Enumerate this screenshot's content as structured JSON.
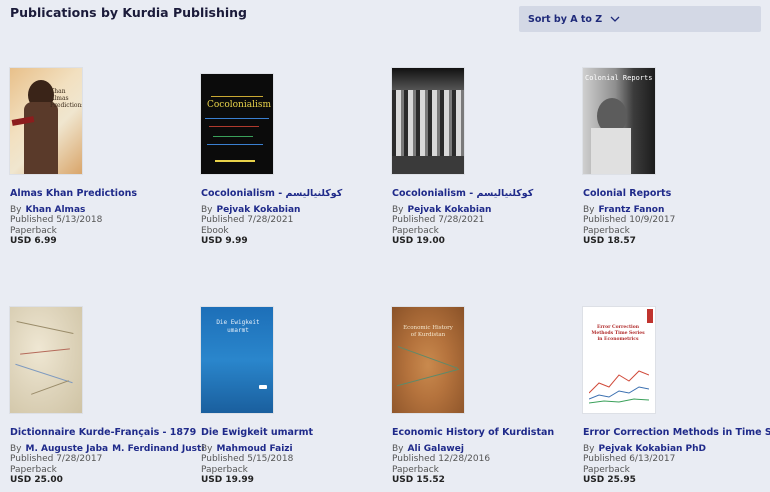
{
  "header": {
    "title": "Publications by Kurdia Publishing",
    "sort_label": "Sort by A to Z"
  },
  "books": [
    {
      "title": "Almas Khan Predictions",
      "by": "By",
      "authors": [
        "Khan Almas"
      ],
      "published": "Published 5/13/2018",
      "format": "Paperback",
      "price": "USD 6.99",
      "cover_text": "Xhan Almas Predictions"
    },
    {
      "title": "Cocolonialism - کوکلنیالیسم",
      "by": "By",
      "authors": [
        "Pejvak Kokabian"
      ],
      "published": "Published 7/28/2021",
      "format": "Ebook",
      "price": "USD 9.99",
      "cover_text": "Cocolonialism"
    },
    {
      "title": "Cocolonialism - کوکلنیالیسم",
      "by": "By",
      "authors": [
        "Pejvak Kokabian"
      ],
      "published": "Published 7/28/2021",
      "format": "Paperback",
      "price": "USD 19.00",
      "cover_text": ""
    },
    {
      "title": "Colonial Reports",
      "by": "By",
      "authors": [
        "Frantz Fanon"
      ],
      "published": "Published 10/9/2017",
      "format": "Paperback",
      "price": "USD 18.57",
      "cover_text": "Colonial Reports"
    },
    {
      "title": "Dictionnaire Kurde-Français - 1879",
      "by": "By",
      "authors": [
        "M. Auguste Jaba",
        "M. Ferdinand Justi"
      ],
      "published": "Published 7/28/2017",
      "format": "Paperback",
      "price": "USD 25.00",
      "cover_text": ""
    },
    {
      "title": "Die Ewigkeit umarmt",
      "by": "By",
      "authors": [
        "Mahmoud Faizi"
      ],
      "published": "Published 5/15/2018",
      "format": "Paperback",
      "price": "USD 19.99",
      "cover_text": "Die Ewigkeit umarmt"
    },
    {
      "title": "Economic History of Kurdistan",
      "by": "By",
      "authors": [
        "Ali Galawej"
      ],
      "published": "Published 12/28/2016",
      "format": "Paperback",
      "price": "USD 15.52",
      "cover_text": "Economic History of Kurdistan"
    },
    {
      "title": "Error Correction Methods in Time Series",
      "by": "By",
      "authors": [
        "Pejvak Kokabian PhD"
      ],
      "published": "Published 6/13/2017",
      "format": "Paperback",
      "price": "USD 25.95",
      "cover_text": "Error Correction Methods Time Series in Econometrics"
    }
  ]
}
